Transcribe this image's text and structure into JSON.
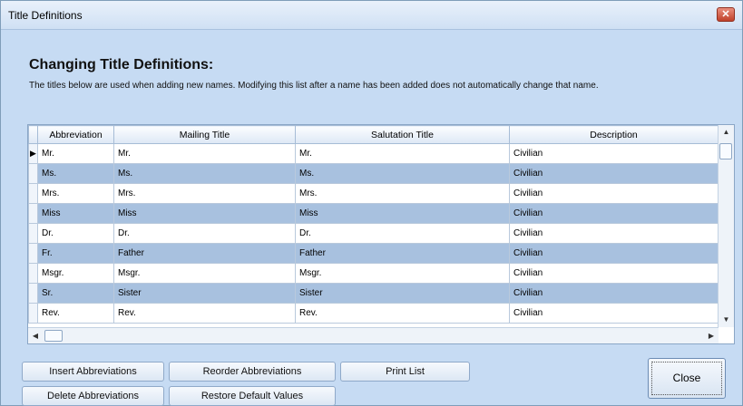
{
  "window": {
    "title": "Title Definitions",
    "close_glyph": "✕"
  },
  "header": "Changing Title Definitions:",
  "description": "The titles below are used when adding new names. Modifying this list after a name has been added does not automatically change that name.",
  "grid": {
    "columns": [
      "Abbreviation",
      "Mailing Title",
      "Salutation Title",
      "Description"
    ],
    "current_row_marker": "▶",
    "rows": [
      [
        "Mr.",
        "Mr.",
        "Mr.",
        "Civilian"
      ],
      [
        "Ms.",
        "Ms.",
        "Ms.",
        "Civilian"
      ],
      [
        "Mrs.",
        "Mrs.",
        "Mrs.",
        "Civilian"
      ],
      [
        "Miss",
        "Miss",
        "Miss",
        "Civilian"
      ],
      [
        "Dr.",
        "Dr.",
        "Dr.",
        "Civilian"
      ],
      [
        "Fr.",
        "Father",
        "Father",
        "Civilian"
      ],
      [
        "Msgr.",
        "Msgr.",
        "Msgr.",
        "Civilian"
      ],
      [
        "Sr.",
        "Sister",
        "Sister",
        "Civilian"
      ],
      [
        "Rev.",
        "Rev.",
        "Rev.",
        "Civilian"
      ]
    ]
  },
  "buttons": {
    "insert": "Insert Abbreviations",
    "reorder": "Reorder Abbreviations",
    "print": "Print List",
    "delete": "Delete Abbreviations",
    "restore": "Restore Default Values",
    "close": "Close"
  },
  "scroll_glyphs": {
    "up": "▲",
    "down": "▼",
    "left": "◀",
    "right": "▶"
  }
}
